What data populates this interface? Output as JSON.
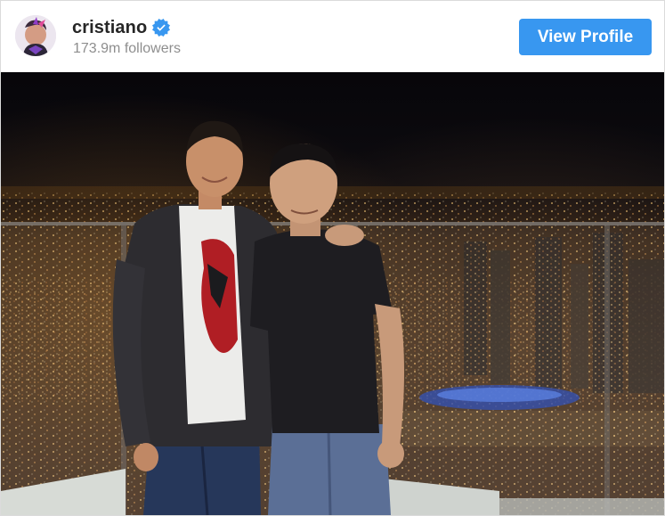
{
  "profile": {
    "username": "cristiano",
    "followers": "173.9m followers",
    "verified": true
  },
  "header": {
    "view_profile_label": "View Profile"
  },
  "colors": {
    "button": "#3897f0",
    "verified_badge": "#3897f0",
    "username": "#262626",
    "muted": "#8e8e8e"
  },
  "icons": {
    "avatar": "profile-avatar",
    "verified": "verified-badge-icon"
  },
  "post": {
    "image": "photo-of-two-men-on-rooftop-at-night-city-view"
  }
}
